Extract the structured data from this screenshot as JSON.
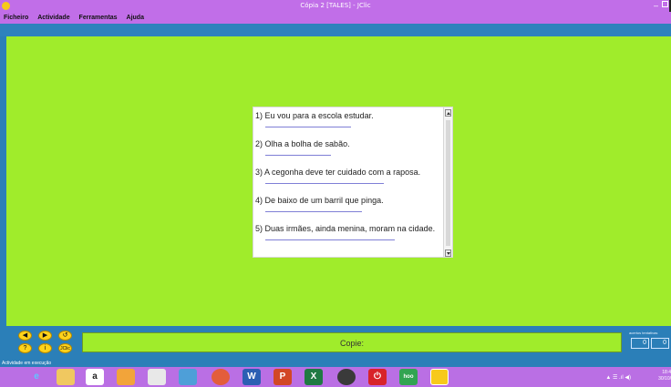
{
  "window": {
    "title": "Cópia 2 [TALES] - JClic"
  },
  "menu": {
    "items": [
      "Ficheiro",
      "Actividade",
      "Ferramentas",
      "Ajuda"
    ]
  },
  "activity": {
    "sentences": [
      "1) Eu vou para a escola estudar.",
      "2) Olha a bolha de sabão.",
      "3) A cegonha deve ter cuidado com a raposa.",
      "4) De baixo de um barril que pinga.",
      "5) Duas irmães, ainda menina, moram na cidade."
    ]
  },
  "message": "Copie:",
  "counters": {
    "labels": "acertos  tentativas",
    "values": [
      "0",
      "0"
    ]
  },
  "status": "Actividade em execução",
  "taskbar": {
    "tray": "▲ ☰ .ıl ◀)",
    "clock_time": "18:4",
    "clock_date": "30/10/"
  },
  "colors": {
    "canvas": "#a0ec2b",
    "frame": "#2b7fb8",
    "titlebar": "#c16ee8"
  }
}
